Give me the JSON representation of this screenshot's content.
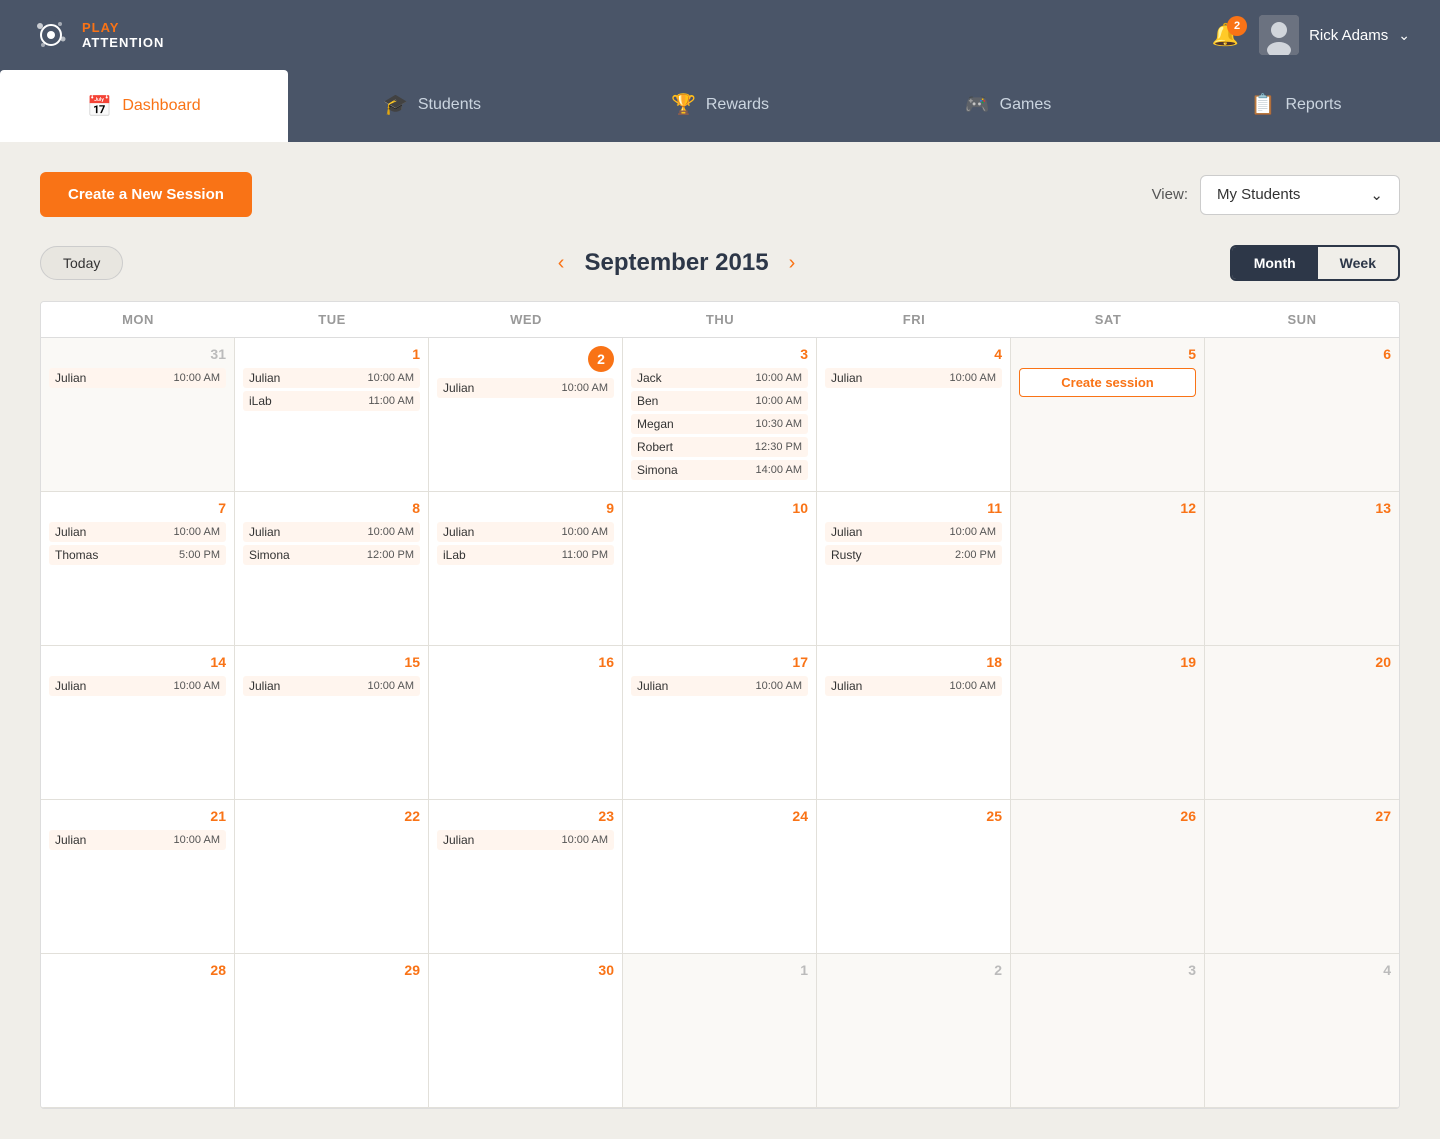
{
  "header": {
    "logo_play": "PLAY",
    "logo_attention": "ATTENTION",
    "notification_count": "2",
    "user_name": "Rick Adams"
  },
  "nav": {
    "tabs": [
      {
        "id": "dashboard",
        "label": "Dashboard",
        "icon": "📅",
        "active": true
      },
      {
        "id": "students",
        "label": "Students",
        "icon": "🎓",
        "active": false
      },
      {
        "id": "rewards",
        "label": "Rewards",
        "icon": "🏆",
        "active": false
      },
      {
        "id": "games",
        "label": "Games",
        "icon": "🎮",
        "active": false
      },
      {
        "id": "reports",
        "label": "Reports",
        "icon": "📋",
        "active": false
      }
    ]
  },
  "toolbar": {
    "create_button": "Create a New Session",
    "view_label": "View:",
    "view_option": "My Students",
    "view_chevron": "⌄"
  },
  "calendar": {
    "today_btn": "Today",
    "prev_btn": "‹",
    "next_btn": "›",
    "month_title": "September 2015",
    "view_month": "Month",
    "view_week": "Week",
    "day_names": [
      "MON",
      "TUE",
      "WED",
      "THU",
      "FRI",
      "SAT",
      "SUN"
    ],
    "weeks": [
      [
        {
          "date": "31",
          "in_month": false,
          "sessions": [
            {
              "name": "Julian",
              "time": "10:00 AM"
            }
          ]
        },
        {
          "date": "1",
          "in_month": true,
          "sessions": [
            {
              "name": "Julian",
              "time": "10:00 AM"
            },
            {
              "name": "iLab",
              "time": "11:00 AM"
            }
          ]
        },
        {
          "date": "2",
          "in_month": true,
          "today": true,
          "sessions": [
            {
              "name": "Julian",
              "time": "10:00 AM"
            }
          ]
        },
        {
          "date": "3",
          "in_month": true,
          "sessions": [
            {
              "name": "Jack",
              "time": "10:00 AM"
            },
            {
              "name": "Ben",
              "time": "10:00 AM"
            },
            {
              "name": "Megan",
              "time": "10:30 AM"
            },
            {
              "name": "Robert",
              "time": "12:30 PM"
            },
            {
              "name": "Simona",
              "time": "14:00 AM"
            }
          ]
        },
        {
          "date": "4",
          "in_month": true,
          "sessions": [
            {
              "name": "Julian",
              "time": "10:00 AM"
            }
          ]
        },
        {
          "date": "5",
          "in_month": true,
          "weekend": true,
          "create_session": true
        },
        {
          "date": "6",
          "in_month": true,
          "weekend": true,
          "sessions": []
        }
      ],
      [
        {
          "date": "7",
          "in_month": true,
          "sessions": [
            {
              "name": "Julian",
              "time": "10:00 AM"
            },
            {
              "name": "Thomas",
              "time": "5:00 PM"
            }
          ]
        },
        {
          "date": "8",
          "in_month": true,
          "sessions": [
            {
              "name": "Julian",
              "time": "10:00 AM"
            },
            {
              "name": "Simona",
              "time": "12:00 PM"
            }
          ]
        },
        {
          "date": "9",
          "in_month": true,
          "sessions": [
            {
              "name": "Julian",
              "time": "10:00 AM"
            },
            {
              "name": "iLab",
              "time": "11:00 PM"
            }
          ]
        },
        {
          "date": "10",
          "in_month": true,
          "sessions": []
        },
        {
          "date": "11",
          "in_month": true,
          "sessions": [
            {
              "name": "Julian",
              "time": "10:00 AM"
            },
            {
              "name": "Rusty",
              "time": "2:00 PM"
            }
          ]
        },
        {
          "date": "12",
          "in_month": true,
          "weekend": true,
          "sessions": []
        },
        {
          "date": "13",
          "in_month": true,
          "weekend": true,
          "sessions": []
        }
      ],
      [
        {
          "date": "14",
          "in_month": true,
          "sessions": [
            {
              "name": "Julian",
              "time": "10:00 AM"
            }
          ]
        },
        {
          "date": "15",
          "in_month": true,
          "sessions": [
            {
              "name": "Julian",
              "time": "10:00 AM"
            }
          ]
        },
        {
          "date": "16",
          "in_month": true,
          "sessions": []
        },
        {
          "date": "17",
          "in_month": true,
          "sessions": [
            {
              "name": "Julian",
              "time": "10:00 AM"
            }
          ]
        },
        {
          "date": "18",
          "in_month": true,
          "sessions": [
            {
              "name": "Julian",
              "time": "10:00 AM"
            }
          ]
        },
        {
          "date": "19",
          "in_month": true,
          "weekend": true,
          "sessions": []
        },
        {
          "date": "20",
          "in_month": true,
          "weekend": true,
          "sessions": []
        }
      ],
      [
        {
          "date": "21",
          "in_month": true,
          "sessions": [
            {
              "name": "Julian",
              "time": "10:00 AM"
            }
          ]
        },
        {
          "date": "22",
          "in_month": true,
          "sessions": []
        },
        {
          "date": "23",
          "in_month": true,
          "sessions": [
            {
              "name": "Julian",
              "time": "10:00 AM"
            }
          ]
        },
        {
          "date": "24",
          "in_month": true,
          "sessions": []
        },
        {
          "date": "25",
          "in_month": true,
          "sessions": []
        },
        {
          "date": "26",
          "in_month": true,
          "weekend": true,
          "sessions": []
        },
        {
          "date": "27",
          "in_month": true,
          "weekend": true,
          "sessions": []
        }
      ],
      [
        {
          "date": "28",
          "in_month": true,
          "sessions": []
        },
        {
          "date": "29",
          "in_month": true,
          "sessions": []
        },
        {
          "date": "30",
          "in_month": true,
          "sessions": []
        },
        {
          "date": "1",
          "in_month": false,
          "sessions": []
        },
        {
          "date": "2",
          "in_month": false,
          "sessions": []
        },
        {
          "date": "3",
          "in_month": false,
          "weekend": true,
          "sessions": []
        },
        {
          "date": "4",
          "in_month": false,
          "weekend": true,
          "sessions": []
        }
      ]
    ],
    "create_session_label": "Create session"
  }
}
